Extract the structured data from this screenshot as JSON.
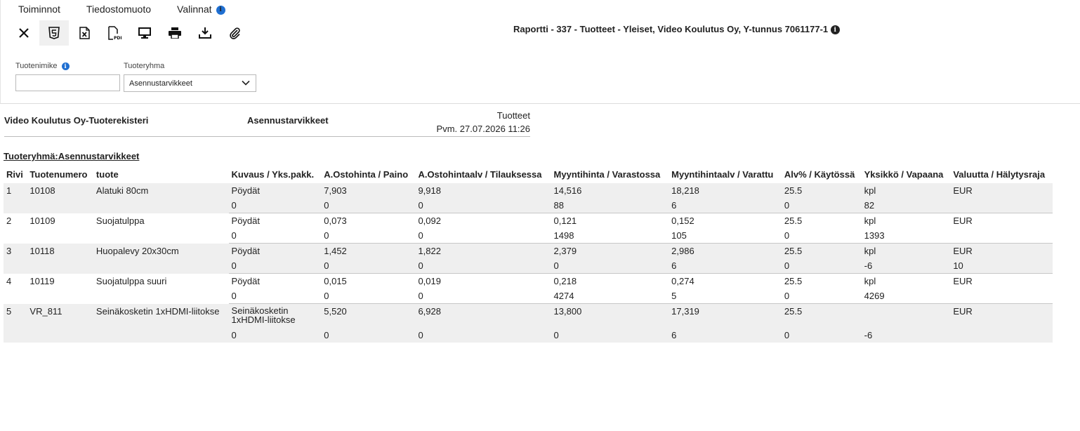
{
  "menu": {
    "toiminnot": "Toiminnot",
    "tiedostomuoto": "Tiedostomuoto",
    "valinnat": "Valinnat",
    "info": "i"
  },
  "toolbar": [
    "close-icon",
    "html5-icon",
    "excel-icon",
    "pdf-icon",
    "monitor-icon",
    "print-icon",
    "download-icon",
    "attachment-icon"
  ],
  "report_title": "Raportti - 337 - Tuotteet - Yleiset, Video Koulutus Oy, Y-tunnus 7061177-1",
  "filters": {
    "tuotenimike_label": "Tuotenimike",
    "tuotenimike_value": "",
    "tuoteryhma_label": "Tuoteryhma",
    "tuoteryhma_value": "Asennustarvikkeet"
  },
  "report_header": {
    "company": "Video Koulutus Oy-Tuoterekisteri",
    "group": "Asennustarvikkeet",
    "type": "Tuotteet",
    "date": "Pvm. 27.07.2026 11:26"
  },
  "group_title": "Tuoteryhmä:Asennustarvikkeet",
  "columns": [
    "Rivi",
    "Tuotenumero",
    "tuote",
    "Kuvaus / Yks.pakk.",
    "A.Ostohinta / Paino",
    "A.Ostohintaalv / Tilauksessa",
    "Myyntihinta / Varastossa",
    "Myyntihintaalv / Varattu",
    "Alv% / Käytössä",
    "Yksikkö / Vapaana",
    "Valuutta / Hälytysraja"
  ],
  "rows": [
    {
      "main": [
        "1",
        "10108",
        "Alatuki 80cm",
        "Pöydät",
        "7,903",
        "9,918",
        "14,516",
        "18,218",
        "25.5",
        "kpl",
        "EUR"
      ],
      "sub": [
        "",
        "",
        "",
        "0",
        "0",
        "0",
        "88",
        "6",
        "0",
        "82",
        ""
      ]
    },
    {
      "main": [
        "2",
        "10109",
        "Suojatulppa",
        "Pöydät",
        "0,073",
        "0,092",
        "0,121",
        "0,152",
        "25.5",
        "kpl",
        "EUR"
      ],
      "sub": [
        "",
        "",
        "",
        "0",
        "0",
        "0",
        "1498",
        "105",
        "0",
        "1393",
        ""
      ]
    },
    {
      "main": [
        "3",
        "10118",
        "Huopalevy 20x30cm",
        "Pöydät",
        "1,452",
        "1,822",
        "2,379",
        "2,986",
        "25.5",
        "kpl",
        "EUR"
      ],
      "sub": [
        "",
        "",
        "",
        "0",
        "0",
        "0",
        "0",
        "6",
        "0",
        "-6",
        "10"
      ]
    },
    {
      "main": [
        "4",
        "10119",
        "Suojatulppa suuri",
        "Pöydät",
        "0,015",
        "0,019",
        "0,218",
        "0,274",
        "25.5",
        "kpl",
        "EUR"
      ],
      "sub": [
        "",
        "",
        "",
        "0",
        "0",
        "0",
        "4274",
        "5",
        "0",
        "4269",
        ""
      ]
    },
    {
      "main": [
        "5",
        "VR_811",
        "Seinäkosketin 1xHDMI-liitokse",
        "Seinäkosketin 1xHDMI-liitokse",
        "5,520",
        "6,928",
        "13,800",
        "17,319",
        "25.5",
        "",
        "EUR"
      ],
      "sub": [
        "",
        "",
        "",
        "0",
        "0",
        "0",
        "0",
        "6",
        "0",
        "-6",
        ""
      ]
    }
  ]
}
